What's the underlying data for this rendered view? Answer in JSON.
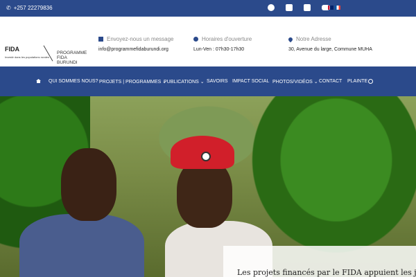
{
  "topbar": {
    "phone": "+257 22279836",
    "social_icons": [
      "facebook-icon",
      "instagram-icon",
      "twitter-icon",
      "youtube-icon"
    ],
    "languages": [
      "en",
      "fr"
    ]
  },
  "header": {
    "logo": {
      "name": "FIDA",
      "tagline": "Investir dans les populations rurales",
      "program_line1": "PROGRAMME",
      "program_line2": "FIDA BURUNDI"
    },
    "contact": {
      "email_label": "Envoyez-nous un message",
      "email_value": "info@programmefidaburundi.org",
      "hours_label": "Horaires d'ouverture",
      "hours_value": "Lun-Ven : 07h30-17h30",
      "address_label": "Notre Adresse",
      "address_value": "30, Avenue du large, Commune MUHA"
    }
  },
  "nav": {
    "items": [
      {
        "label": "QUI SOMMES NOUS?"
      },
      {
        "label": "PROJETS | PROGRAMMES ⌄"
      },
      {
        "label": "PUBLICATIONS ⌄"
      },
      {
        "label": "SAVOIRS"
      },
      {
        "label": "IMPACT SOCIAL"
      },
      {
        "label": "PHOTOS/VIDÉOS ⌄"
      },
      {
        "label": "CONTACT"
      },
      {
        "label": "PLAINTE"
      }
    ]
  },
  "hero": {
    "caption": "Les projets financés par le FIDA appuient les jeunes"
  },
  "colors": {
    "primary": "#2b4a8b",
    "text_dark": "#222222",
    "label_gray": "#888888"
  }
}
